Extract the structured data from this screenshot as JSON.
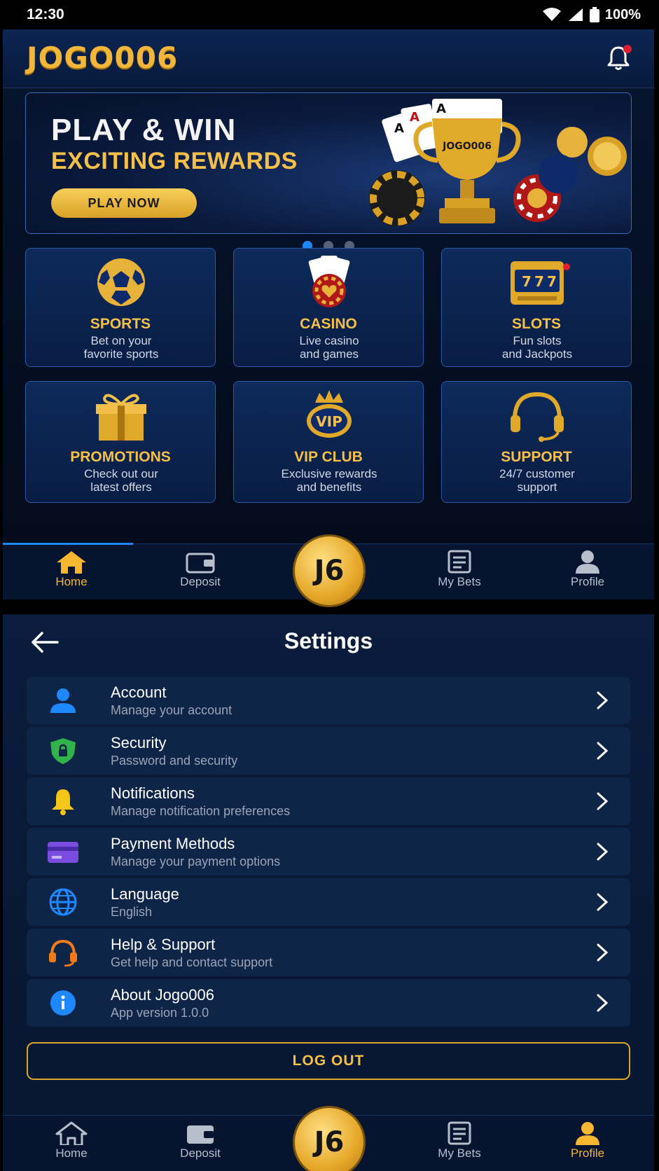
{
  "status_bar": {
    "time": "12:30",
    "battery": "100%"
  },
  "home": {
    "app_title": "JOGO006",
    "banner": {
      "title_line1": "PLAY & WIN",
      "title_line2": "EXCITING REWARDS",
      "cta_label": "PLAY NOW",
      "trophy_text": "JOGO006",
      "carousel_pages": 3,
      "carousel_active": 1
    },
    "tiles": [
      {
        "icon": "soccer-ball-icon",
        "title": "SPORTS",
        "desc_line1": "Bet on your",
        "desc_line2": "favorite sports"
      },
      {
        "icon": "cards-chip-icon",
        "title": "CASINO",
        "desc_line1": "Live casino",
        "desc_line2": "and games"
      },
      {
        "icon": "slot-machine-icon",
        "title": "SLOTS",
        "desc_line1": "Fun slots",
        "desc_line2": "and Jackpots"
      },
      {
        "icon": "gift-icon",
        "title": "PROMOTIONS",
        "desc_line1": "Check out our",
        "desc_line2": "latest offers"
      },
      {
        "icon": "vip-crown-icon",
        "title": "VIP CLUB",
        "desc_line1": "Exclusive rewards",
        "desc_line2": "and benefits"
      },
      {
        "icon": "headset-icon",
        "title": "SUPPORT",
        "desc_line1": "24/7 customer",
        "desc_line2": "support"
      }
    ]
  },
  "bottom_nav": {
    "center_logo": "J6",
    "items": [
      "Home",
      "Deposit",
      "My Bets",
      "Profile"
    ]
  },
  "settings": {
    "title": "Settings",
    "items": [
      {
        "label": "Account",
        "sub": "Manage your account",
        "icon": "user-icon",
        "color": "#1e88ff"
      },
      {
        "label": "Security",
        "sub": "Password and security",
        "icon": "shield-lock-icon",
        "color": "#2fb34a"
      },
      {
        "label": "Notifications",
        "sub": "Manage notification preferences",
        "icon": "bell-icon",
        "color": "#f5c518"
      },
      {
        "label": "Payment Methods",
        "sub": "Manage your payment options",
        "icon": "credit-card-icon",
        "color": "#7a4de0"
      },
      {
        "label": "Language",
        "sub": "English",
        "icon": "globe-icon",
        "color": "#1e88ff"
      },
      {
        "label": "Help & Support",
        "sub": "Get help and contact support",
        "icon": "headset-icon",
        "color": "#f07a1a"
      },
      {
        "label": "About Jogo006",
        "sub": "App version 1.0.0",
        "icon": "info-icon",
        "color": "#1e88ff"
      }
    ],
    "logout_label": "LOG OUT"
  },
  "colors": {
    "accent_gold": "#f5c04a",
    "accent_blue": "#1e88ff",
    "background": "#06152e"
  }
}
